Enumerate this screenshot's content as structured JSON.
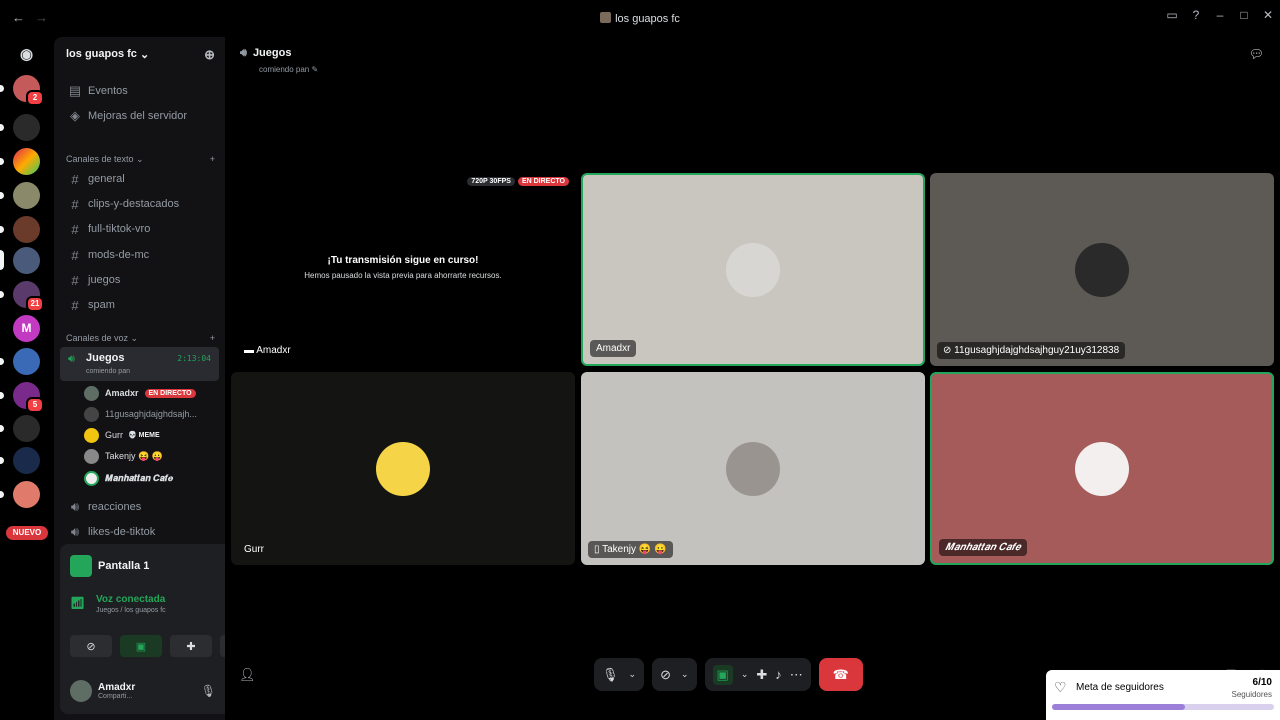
{
  "window": {
    "title": "los guapos fc"
  },
  "colors": {
    "accent_green": "#23a55a",
    "live_red": "#da373c",
    "widget_fill": "#9c7fd8"
  },
  "servers": {
    "badges": [
      "2",
      "21",
      "5"
    ],
    "new_label": "NUEVO"
  },
  "sidebar": {
    "server_name": "los guapos fc",
    "top_items": [
      "Eventos",
      "Mejoras del servidor"
    ],
    "text_category": "Canales de texto",
    "text_channels": [
      "general",
      "clips-y-destacados",
      "full-tiktok-vro",
      "mods-de-mc",
      "juegos",
      "spam"
    ],
    "voice_category": "Canales de voz",
    "active_voice": {
      "name": "Juegos",
      "time": "2:13:04",
      "status": "comiendo pan"
    },
    "members": [
      {
        "name": "Amadxr",
        "live": "EN DIRECTO"
      },
      {
        "name": "11gusaghjdajghdsajh..."
      },
      {
        "name": "Gurr",
        "tag": "💀 MEME"
      },
      {
        "name": "Takenjy 😝 😛"
      },
      {
        "name": "𝑴𝒂𝒏𝒉𝒂𝒕𝒕𝒂𝒏 𝑪𝒂𝒇𝒆"
      }
    ],
    "other_voice": [
      "reacciones",
      "likes-de-tiktok"
    ]
  },
  "panel": {
    "screen_label": "Pantalla 1",
    "voice_status": "Voz conectada",
    "voice_location": "Juegos / los guapos fc",
    "user_name": "Amadxr",
    "user_status": "Comparti..."
  },
  "main": {
    "channel_name": "Juegos",
    "channel_status": "comiendo pan",
    "stream": {
      "quality": "720P 30FPS",
      "live": "EN DIRECTO",
      "heading": "¡Tu transmisión sigue en curso!",
      "text": "Hemos pausado la vista previa para ahorrarte recursos.",
      "owner": "Amadxr"
    },
    "tiles": [
      "Amadxr",
      "11gusaghjdajghdsajhguy21uy312838",
      "Gurr",
      "Takenjy 😝 😛",
      "𝑴𝒂𝒏𝒉𝒂𝒕𝒕𝒂𝒏 𝑪𝒂𝒇𝒆"
    ]
  },
  "widget": {
    "title": "Meta de seguidores",
    "count": "6/10",
    "subtitle": "Seguidores",
    "progress": 0.6
  }
}
